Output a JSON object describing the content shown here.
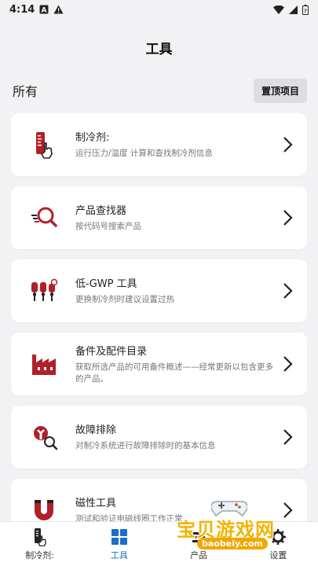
{
  "status_bar": {
    "time": "4:14"
  },
  "app_bar": {
    "title": "工具"
  },
  "section": {
    "label": "所有",
    "pin_button": "置顶项目"
  },
  "tools": [
    {
      "title": "制冷剂:",
      "desc": "运行压力/温度 计算和查找制冷剂信息",
      "icon": "thermometer-hand-icon"
    },
    {
      "title": "产品查找器",
      "desc": "按代码号搜索产品",
      "icon": "search-magnifier-icon"
    },
    {
      "title": "低-GWP 工具",
      "desc": "更换制冷剂时建议设置过热",
      "icon": "cylinders-icon"
    },
    {
      "title": "备件及配件目录",
      "desc": "获取所选产品的可用备件概述——经常更新以包含更多的产品。",
      "icon": "factory-icon"
    },
    {
      "title": "故障排除",
      "desc": "对制冷系统进行故障排除时的基本信息",
      "icon": "wrench-search-icon"
    },
    {
      "title": "磁性工具",
      "desc": "测试和验证电磁线圈工作正常",
      "icon": "magnet-icon"
    }
  ],
  "bottom_nav": [
    {
      "label": "制冷剂:",
      "icon": "thermometer-hand-icon",
      "active": false
    },
    {
      "label": "工具",
      "icon": "grid-icon",
      "active": true
    },
    {
      "label": "产品",
      "icon": "product-icon",
      "active": false
    },
    {
      "label": "设置",
      "icon": "gear-icon",
      "active": false
    }
  ],
  "watermark": {
    "text": "宝贝游戏网",
    "url": "baobeiy.com"
  },
  "colors": {
    "accent_red": "#b0202a",
    "nav_active": "#1d6fc4",
    "background": "#f2f2f4"
  }
}
